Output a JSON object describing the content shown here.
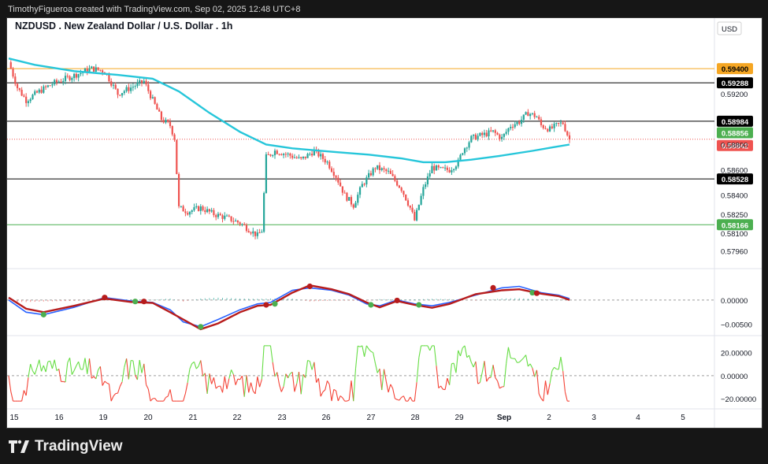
{
  "attribution": "TimothyFigueroa created with TradingView.com, Sep 02, 2025 12:48 UTC+8",
  "brand": "TradingView",
  "symbol_title": "NZDUSD . New Zealand Dollar / U.S. Dollar . 1h",
  "currency_label": "USD",
  "colors": {
    "up": "#26a69a",
    "down": "#ef5350",
    "ma": "#26c6da",
    "hline": "#000000",
    "hline_orange": "#f5a623",
    "hline_green": "#4caf50",
    "osc_fast": "#2962ff",
    "osc_slow": "#b71c1c",
    "osc_green": "#4caf50",
    "rsi_up": "#66dd44",
    "rsi_down": "#f44336"
  },
  "chart_data": [
    {
      "type": "candlestick",
      "title": "NZDUSD . New Zealand Dollar / U.S. Dollar . 1h",
      "ylim": [
        0.579,
        0.5955
      ],
      "y_ticks": [
        "0.59200",
        "0.58800",
        "0.58600",
        "0.58400",
        "0.58250",
        "0.58100",
        "0.57960"
      ],
      "x_ticks": [
        "15",
        "16",
        "19",
        "20",
        "21",
        "22",
        "23",
        "26",
        "27",
        "28",
        "29",
        "Sep",
        "2",
        "3",
        "4",
        "5"
      ],
      "close_path": [
        [
          0,
          0.5945
        ],
        [
          4,
          0.5925
        ],
        [
          8,
          0.5915
        ],
        [
          14,
          0.5922
        ],
        [
          20,
          0.5928
        ],
        [
          26,
          0.5932
        ],
        [
          32,
          0.5936
        ],
        [
          38,
          0.594
        ],
        [
          44,
          0.5938
        ],
        [
          50,
          0.592
        ],
        [
          56,
          0.5925
        ],
        [
          62,
          0.593
        ],
        [
          66,
          0.5915
        ],
        [
          70,
          0.59
        ],
        [
          74,
          0.5895
        ],
        [
          76,
          0.5885
        ],
        [
          78,
          0.583
        ],
        [
          82,
          0.5827
        ],
        [
          88,
          0.583
        ],
        [
          94,
          0.5825
        ],
        [
          100,
          0.5822
        ],
        [
          106,
          0.5818
        ],
        [
          110,
          0.5813
        ],
        [
          114,
          0.5808
        ],
        [
          116,
          0.5812
        ],
        [
          118,
          0.587
        ],
        [
          122,
          0.5875
        ],
        [
          128,
          0.5872
        ],
        [
          134,
          0.5868
        ],
        [
          140,
          0.5875
        ],
        [
          146,
          0.5866
        ],
        [
          150,
          0.5855
        ],
        [
          154,
          0.584
        ],
        [
          158,
          0.5832
        ],
        [
          162,
          0.5848
        ],
        [
          168,
          0.5862
        ],
        [
          174,
          0.5858
        ],
        [
          180,
          0.5845
        ],
        [
          184,
          0.583
        ],
        [
          186,
          0.582
        ],
        [
          190,
          0.5845
        ],
        [
          194,
          0.5862
        ],
        [
          198,
          0.586
        ],
        [
          202,
          0.586
        ],
        [
          206,
          0.5866
        ],
        [
          208,
          0.5875
        ],
        [
          212,
          0.5885
        ],
        [
          218,
          0.5888
        ],
        [
          222,
          0.589
        ],
        [
          226,
          0.5885
        ],
        [
          230,
          0.5895
        ],
        [
          234,
          0.5898
        ],
        [
          238,
          0.5905
        ],
        [
          242,
          0.5902
        ],
        [
          244,
          0.5895
        ],
        [
          248,
          0.5892
        ],
        [
          252,
          0.5896
        ],
        [
          254,
          0.5897
        ],
        [
          256,
          0.5888
        ],
        [
          257,
          0.5884
        ]
      ],
      "ma_path": [
        [
          0,
          0.5948
        ],
        [
          12,
          0.5943
        ],
        [
          30,
          0.5938
        ],
        [
          50,
          0.5935
        ],
        [
          66,
          0.5932
        ],
        [
          78,
          0.5922
        ],
        [
          92,
          0.5905
        ],
        [
          106,
          0.589
        ],
        [
          118,
          0.588
        ],
        [
          130,
          0.5877
        ],
        [
          150,
          0.5874
        ],
        [
          165,
          0.5872
        ],
        [
          180,
          0.5869
        ],
        [
          190,
          0.5866
        ],
        [
          200,
          0.5866
        ],
        [
          212,
          0.5868
        ],
        [
          225,
          0.5871
        ],
        [
          240,
          0.5875
        ],
        [
          250,
          0.5878
        ],
        [
          257,
          0.588
        ]
      ],
      "hlines": [
        {
          "value": 0.594,
          "label": "0.59400",
          "style": "orange"
        },
        {
          "value": 0.59288,
          "label": "0.59288",
          "style": "black"
        },
        {
          "value": 0.58984,
          "label": "0.58984",
          "style": "black"
        },
        {
          "value": 0.58528,
          "label": "0.58528",
          "style": "black"
        },
        {
          "value": 0.58166,
          "label": "0.58166",
          "style": "green"
        }
      ],
      "price_tags": [
        {
          "value": 0.58856,
          "label": "0.58856",
          "color": "green"
        },
        {
          "value": 0.58842,
          "label": "0.58842",
          "color": "red"
        }
      ]
    },
    {
      "type": "line",
      "name": "oscillator",
      "ylim": [
        -0.0065,
        0.0045
      ],
      "y_ticks": [
        "0.00000",
        "−0.00500"
      ],
      "fast": [
        [
          0,
          0.0
        ],
        [
          8,
          -0.0025
        ],
        [
          16,
          -0.003
        ],
        [
          30,
          -0.0015
        ],
        [
          44,
          0.0005
        ],
        [
          56,
          -0.0002
        ],
        [
          66,
          -0.0005
        ],
        [
          74,
          -0.002
        ],
        [
          80,
          -0.0045
        ],
        [
          88,
          -0.0055
        ],
        [
          96,
          -0.004
        ],
        [
          106,
          -0.002
        ],
        [
          114,
          -0.0008
        ],
        [
          120,
          -0.0005
        ],
        [
          130,
          0.002
        ],
        [
          138,
          0.0025
        ],
        [
          148,
          0.002
        ],
        [
          156,
          0.001
        ],
        [
          164,
          -0.0008
        ],
        [
          170,
          -0.0012
        ],
        [
          178,
          0.0
        ],
        [
          186,
          -0.0008
        ],
        [
          194,
          -0.0012
        ],
        [
          202,
          -0.0005
        ],
        [
          214,
          0.001
        ],
        [
          226,
          0.0025
        ],
        [
          234,
          0.0028
        ],
        [
          244,
          0.0015
        ],
        [
          252,
          0.001
        ],
        [
          257,
          0.0003
        ]
      ],
      "slow": [
        [
          0,
          0.0005
        ],
        [
          8,
          -0.0018
        ],
        [
          16,
          -0.0025
        ],
        [
          30,
          -0.0012
        ],
        [
          44,
          0.0003
        ],
        [
          56,
          -0.0004
        ],
        [
          66,
          -0.0006
        ],
        [
          74,
          -0.0025
        ],
        [
          80,
          -0.004
        ],
        [
          88,
          -0.006
        ],
        [
          96,
          -0.0048
        ],
        [
          106,
          -0.0025
        ],
        [
          114,
          -0.0012
        ],
        [
          120,
          -0.001
        ],
        [
          130,
          0.0015
        ],
        [
          138,
          0.003
        ],
        [
          148,
          0.0022
        ],
        [
          156,
          0.0012
        ],
        [
          164,
          -0.0005
        ],
        [
          170,
          -0.0015
        ],
        [
          178,
          -0.0002
        ],
        [
          186,
          -0.001
        ],
        [
          194,
          -0.0016
        ],
        [
          202,
          -0.0008
        ],
        [
          214,
          0.0012
        ],
        [
          226,
          0.002
        ],
        [
          234,
          0.0022
        ],
        [
          244,
          0.0013
        ],
        [
          252,
          0.0008
        ],
        [
          257,
          0.0
        ]
      ],
      "dots": [
        {
          "x": 16,
          "y": -0.003,
          "kind": "green"
        },
        {
          "x": 44,
          "y": 0.0005,
          "kind": "red"
        },
        {
          "x": 58,
          "y": -0.0003,
          "kind": "green"
        },
        {
          "x": 62,
          "y": -0.0003,
          "kind": "red"
        },
        {
          "x": 88,
          "y": -0.0055,
          "kind": "green"
        },
        {
          "x": 118,
          "y": -0.001,
          "kind": "red"
        },
        {
          "x": 122,
          "y": -0.0008,
          "kind": "green"
        },
        {
          "x": 138,
          "y": 0.0028,
          "kind": "red"
        },
        {
          "x": 166,
          "y": -0.001,
          "kind": "green"
        },
        {
          "x": 178,
          "y": -0.0001,
          "kind": "red"
        },
        {
          "x": 188,
          "y": -0.001,
          "kind": "green"
        },
        {
          "x": 222,
          "y": 0.0025,
          "kind": "red"
        },
        {
          "x": 240,
          "y": 0.0015,
          "kind": "green"
        },
        {
          "x": 242,
          "y": 0.0014,
          "kind": "red"
        }
      ]
    },
    {
      "type": "line",
      "name": "momentum",
      "ylim": [
        -26,
        30
      ],
      "y_ticks": [
        "20.00000",
        "0.00000",
        "−20.00000"
      ],
      "x_ticks_used": "shared"
    }
  ]
}
